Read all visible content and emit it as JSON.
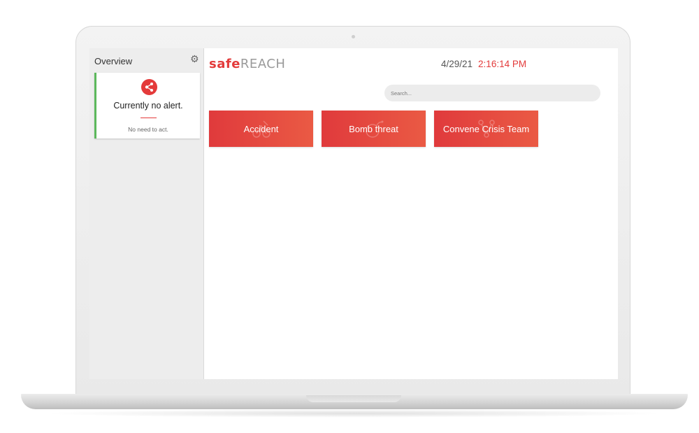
{
  "sidebar": {
    "title": "Overview",
    "settings_icon": "gear-icon",
    "alert_card": {
      "icon": "share-network-icon",
      "title": "Currently no alert.",
      "subtitle": "No need to act.",
      "status_color": "#5cb85c"
    }
  },
  "header": {
    "logo_part1": "safe",
    "logo_part2": "REACH",
    "date": "4/29/21",
    "time": "2:16:14 PM"
  },
  "search": {
    "placeholder": "Search..."
  },
  "actions": [
    {
      "label": "Accident",
      "icon": "accident-icon"
    },
    {
      "label": "Bomb threat",
      "icon": "bomb-icon"
    },
    {
      "label": "Convene Crisis Team",
      "icon": "network-icon"
    }
  ],
  "colors": {
    "accent": "#e33b3b",
    "button_gradient_start": "#e03a3c",
    "button_gradient_end": "#ea5a44"
  }
}
